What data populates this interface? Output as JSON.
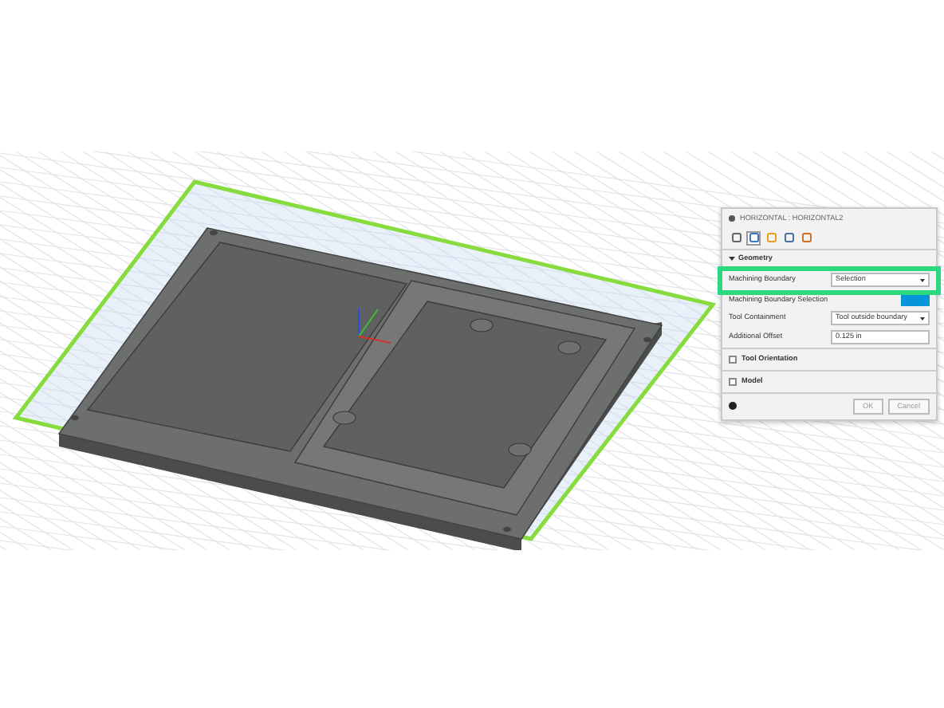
{
  "dialog": {
    "title": "HORIZONTAL : HORIZONTAL2",
    "tabs": [
      {
        "selected": false
      },
      {
        "selected": true
      },
      {
        "selected": false
      },
      {
        "selected": false
      },
      {
        "selected": false
      }
    ],
    "sections": [
      {
        "title": "Geometry",
        "expanded": true,
        "fields": [
          {
            "kind": "select",
            "label": "Machining Boundary",
            "value": "Selection",
            "highlighted": true
          },
          {
            "kind": "selection",
            "label": "Machining Boundary Selection",
            "highlighted": false
          },
          {
            "kind": "select",
            "label": "Tool Containment",
            "value": "Tool outside boundary",
            "highlighted": false
          },
          {
            "kind": "number",
            "label": "Additional Offset",
            "value": "0.125 in",
            "highlighted": false
          }
        ]
      },
      {
        "title": "Tool Orientation",
        "expanded": false,
        "checked": false
      },
      {
        "title": "Model",
        "expanded": false,
        "checked": false
      }
    ],
    "buttons": [
      "OK",
      "Cancel"
    ]
  }
}
